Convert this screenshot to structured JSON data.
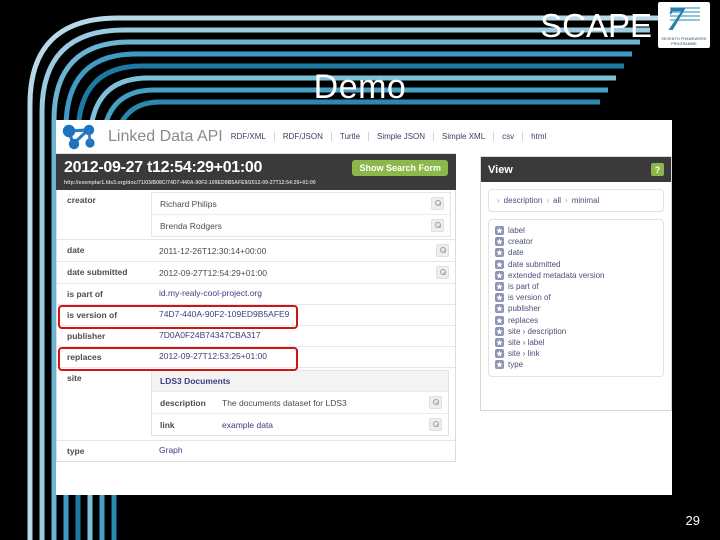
{
  "slide": {
    "brand": "SCAPE",
    "eu_logo_line1": "SEVENTH FRAMEWORK",
    "eu_logo_line2": "PROGRAMME",
    "eu_logo_number": "7",
    "title": "Demo",
    "page_number": "29"
  },
  "app": {
    "name": "Linked Data API",
    "formats": [
      {
        "label": "RDF/XML"
      },
      {
        "label": "RDF/JSON"
      },
      {
        "label": "Turtle"
      },
      {
        "label": "Simple JSON"
      },
      {
        "label": "Simple XML"
      },
      {
        "label": "csv"
      },
      {
        "label": "html"
      }
    ],
    "doc_header": {
      "timestamp": "2012-09-27 t12:54:29+01:00",
      "search_button": "Show Search Form",
      "uri": "http://exemplar1.lds3.org/doc/71/03/B08C/74D7-440A-90F2-109ED9B5AFE9/2012-09-27T12:54:29+01:00"
    },
    "properties": [
      {
        "label": "creator",
        "style": "grouped",
        "values": [
          {
            "text": "Richard Philips",
            "magnifier": true,
            "link": false
          },
          {
            "text": "Brenda Rodgers",
            "magnifier": true,
            "link": false
          }
        ]
      },
      {
        "label": "date",
        "style": "plain",
        "values": [
          {
            "text": "2011-12-26T12:30:14+00:00",
            "magnifier": true,
            "link": false
          }
        ]
      },
      {
        "label": "date submitted",
        "style": "plain",
        "values": [
          {
            "text": "2012-09-27T12:54:29+01:00",
            "magnifier": true,
            "link": false
          }
        ]
      },
      {
        "label": "is part of",
        "style": "plain",
        "values": [
          {
            "text": "id.my-realy-cool-project.org",
            "magnifier": false,
            "link": true
          }
        ]
      },
      {
        "label": "is version of",
        "style": "plain",
        "highlighted": true,
        "values": [
          {
            "text": "74D7-440A-90F2-109ED9B5AFE9",
            "magnifier": false,
            "link": true
          }
        ]
      },
      {
        "label": "publisher",
        "style": "plain",
        "values": [
          {
            "text": "7D0A0F24B74347CBA317",
            "magnifier": false,
            "link": true
          }
        ]
      },
      {
        "label": "replaces",
        "style": "plain",
        "highlighted": true,
        "values": [
          {
            "text": "2012-09-27T12:53:25+01:00",
            "magnifier": false,
            "link": true
          }
        ]
      },
      {
        "label": "site",
        "style": "nested",
        "nested": {
          "title": "LDS3 Documents",
          "rows": [
            {
              "key": "description",
              "value": "The documents dataset for LDS3",
              "magnifier": true,
              "link": false
            },
            {
              "key": "link",
              "value": "example data",
              "magnifier": true,
              "link": true
            }
          ]
        }
      },
      {
        "label": "type",
        "style": "plain",
        "values": [
          {
            "text": "Graph",
            "magnifier": false,
            "link": true
          }
        ]
      }
    ]
  },
  "view_panel": {
    "title": "View",
    "help_label": "?",
    "breadcrumb": [
      "description",
      "all",
      "minimal"
    ],
    "chevron": "›",
    "properties": [
      "label",
      "creator",
      "date",
      "date submitted",
      "extended metadata version",
      "is part of",
      "is version of",
      "publisher",
      "replaces",
      "site › description",
      "site › label",
      "site › link",
      "type"
    ]
  },
  "colors": {
    "slide_bg": "#000000",
    "swoosh_dark": "#1b7ba3",
    "swoosh_light": "#a8d3e6",
    "accent_green": "#8cb84b",
    "highlight_red": "#d01414",
    "dark_header": "#3a3a3c",
    "link_blue": "#3a3f7d"
  }
}
